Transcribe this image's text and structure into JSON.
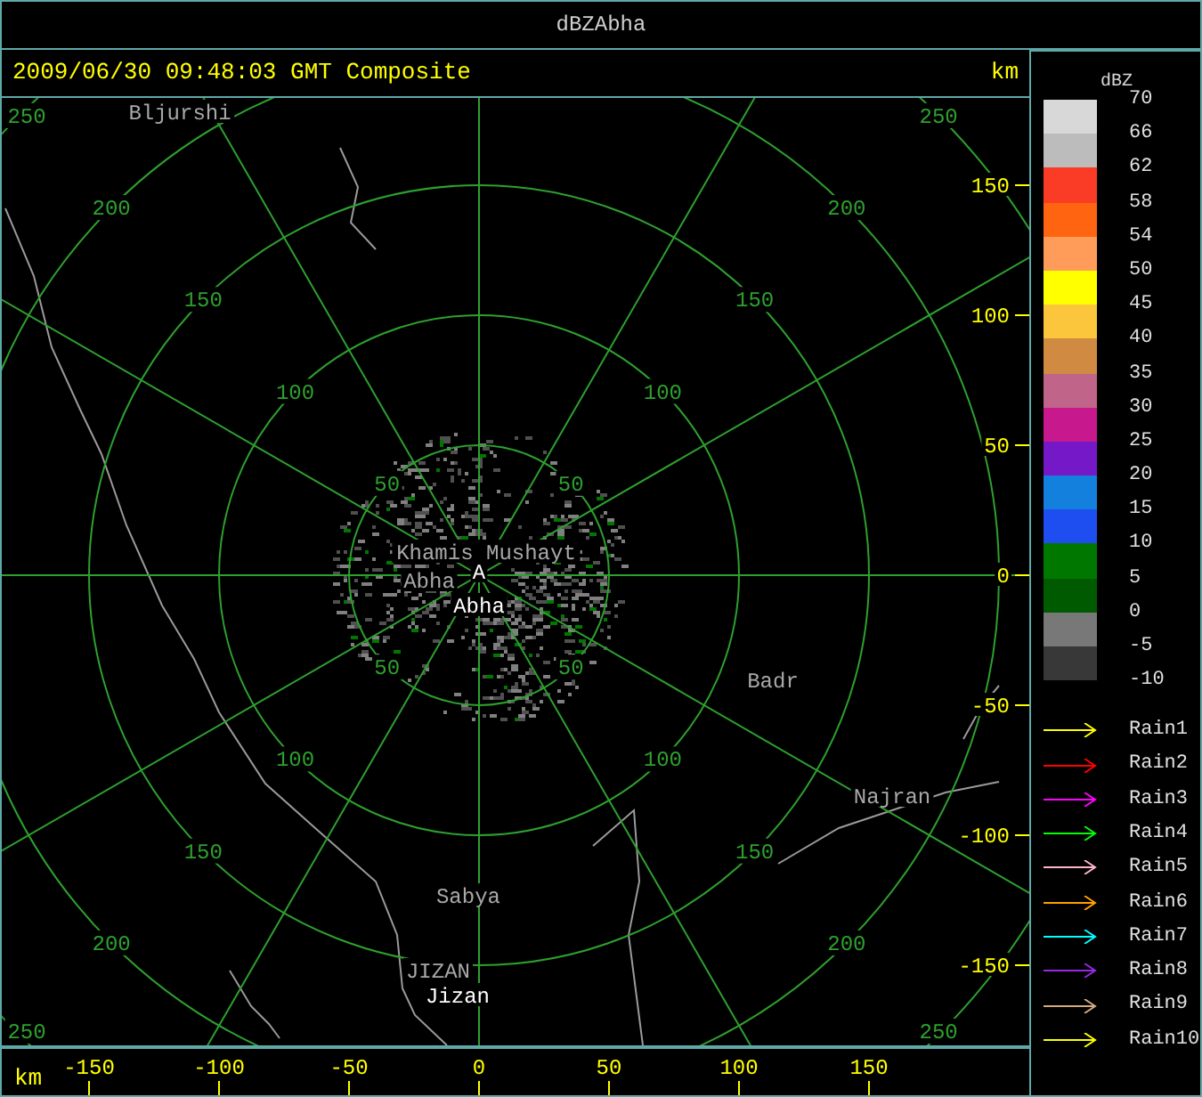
{
  "window": {
    "title": "dBZAbha"
  },
  "header": {
    "timestamp": "2009/06/30 09:48:03 GMT Composite",
    "unit": "km"
  },
  "radar": {
    "rings": [
      {
        "labels": [
          "50",
          "50",
          "50",
          "50"
        ]
      },
      {
        "labels": [
          "100",
          "100",
          "100",
          "100"
        ]
      },
      {
        "labels": [
          "150",
          "150",
          "150",
          "150"
        ]
      },
      {
        "labels": [
          "200",
          "200",
          "200",
          "200"
        ]
      },
      {
        "labels": [
          "250",
          "250",
          "250",
          "250"
        ]
      }
    ],
    "places": [
      {
        "name": "Bljurshi",
        "kind": "town"
      },
      {
        "name": "Khamis_Mushayt",
        "kind": "town"
      },
      {
        "name": "Abha",
        "kind": "town"
      },
      {
        "name": "A",
        "kind": "site"
      },
      {
        "name": "Abha",
        "kind": "site"
      },
      {
        "name": "Badr",
        "kind": "town"
      },
      {
        "name": "Najran",
        "kind": "town"
      },
      {
        "name": "Sabya",
        "kind": "town"
      },
      {
        "name": "JIZAN",
        "kind": "town"
      },
      {
        "name": "Jizan",
        "kind": "site"
      }
    ],
    "y_ticks": [
      "150",
      "100",
      "50",
      "0",
      "-50",
      "-100",
      "-150"
    ]
  },
  "x_axis": {
    "unit": "km",
    "ticks": [
      "-150",
      "-100",
      "-50",
      "0",
      "50",
      "100",
      "150"
    ]
  },
  "legend": {
    "title": "dBZ",
    "levels": [
      {
        "label": "70",
        "color": "#d8d8d8"
      },
      {
        "label": "66",
        "color": "#bcbcbc"
      },
      {
        "label": "62",
        "color": "#fa3c26"
      },
      {
        "label": "58",
        "color": "#ff6410"
      },
      {
        "label": "54",
        "color": "#ff9c5a"
      },
      {
        "label": "50",
        "color": "#ffff00"
      },
      {
        "label": "45",
        "color": "#fcc63c"
      },
      {
        "label": "40",
        "color": "#d08a42"
      },
      {
        "label": "35",
        "color": "#c0648a"
      },
      {
        "label": "30",
        "color": "#c8188e"
      },
      {
        "label": "25",
        "color": "#7418c8"
      },
      {
        "label": "20",
        "color": "#1280dc"
      },
      {
        "label": "15",
        "color": "#1e4ef0"
      },
      {
        "label": "10",
        "color": "#007800"
      },
      {
        "label": "5",
        "color": "#005a00"
      },
      {
        "label": "0",
        "color": "#787878"
      },
      {
        "label": "-5",
        "color": "#383838"
      },
      {
        "label": "-10"
      }
    ],
    "tracks": [
      {
        "name": "Rain1",
        "color": "#ffff00"
      },
      {
        "name": "Rain2",
        "color": "#ff0000"
      },
      {
        "name": "Rain3",
        "color": "#ff00ff"
      },
      {
        "name": "Rain4",
        "color": "#00ff00"
      },
      {
        "name": "Rain5",
        "color": "#ffb4c8"
      },
      {
        "name": "Rain6",
        "color": "#ffa000"
      },
      {
        "name": "Rain7",
        "color": "#00ffff"
      },
      {
        "name": "Rain8",
        "color": "#9628e6"
      },
      {
        "name": "Rain9",
        "color": "#d2aa82"
      },
      {
        "name": "Rain10",
        "color": "#ffff00"
      }
    ]
  }
}
